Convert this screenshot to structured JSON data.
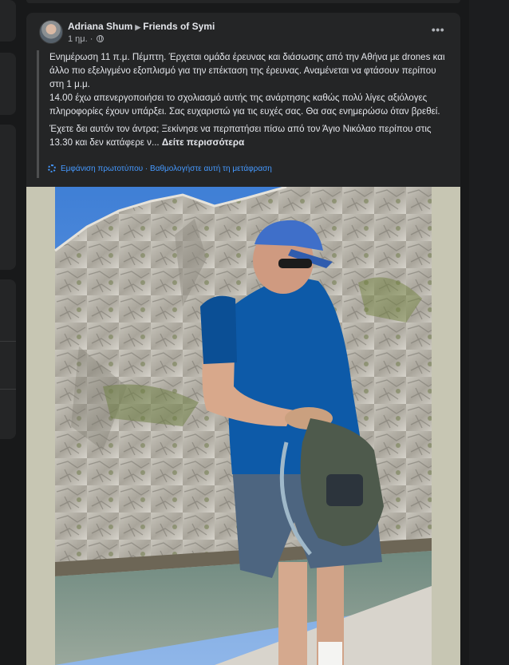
{
  "post": {
    "author": "Adriana Shum",
    "group": "Friends of Symi",
    "time": "1 ημ.",
    "privacy_icon": "globe-icon",
    "more_icon": "ellipsis-icon",
    "paragraphs": [
      "Ενημέρωση 11 π.μ. Πέμπτη. Έρχεται ομάδα έρευνας και διάσωσης από την Αθήνα με drones και άλλο πιο εξελιγμένο εξοπλισμό για την επέκταση της έρευνας. Αναμένεται να φτάσουν περίπου στη 1 μ.μ.",
      "14.00 έχω απενεργοποιήσει το σχολιασμό αυτής της ανάρτησης καθώς πολύ λίγες αξιόλογες πληροφορίες έχουν υπάρξει. Σας ευχαριστώ για τις ευχές σας. Θα σας ενημερώσω όταν βρεθεί."
    ],
    "last_paragraph": "Έχετε δει αυτόν τον άντρα; Ξεκίνησε να περπατήσει πίσω από τον Άγιο Νικόλαο περίπου στις 13.30 και δεν κατάφερε ν...",
    "see_more": "Δείτε περισσότερα",
    "show_original": "Εμφάνιση πρωτοτύπου",
    "separator": "·",
    "rate_translation": "Βαθμολογήστε αυτή τη μετάφραση"
  },
  "colors": {
    "page_bg": "#18191a",
    "card_bg": "#242526",
    "text_primary": "#e4e6eb",
    "text_secondary": "#b0b3b8",
    "link": "#4599ff",
    "photo_mat": "#c7c6b3"
  }
}
